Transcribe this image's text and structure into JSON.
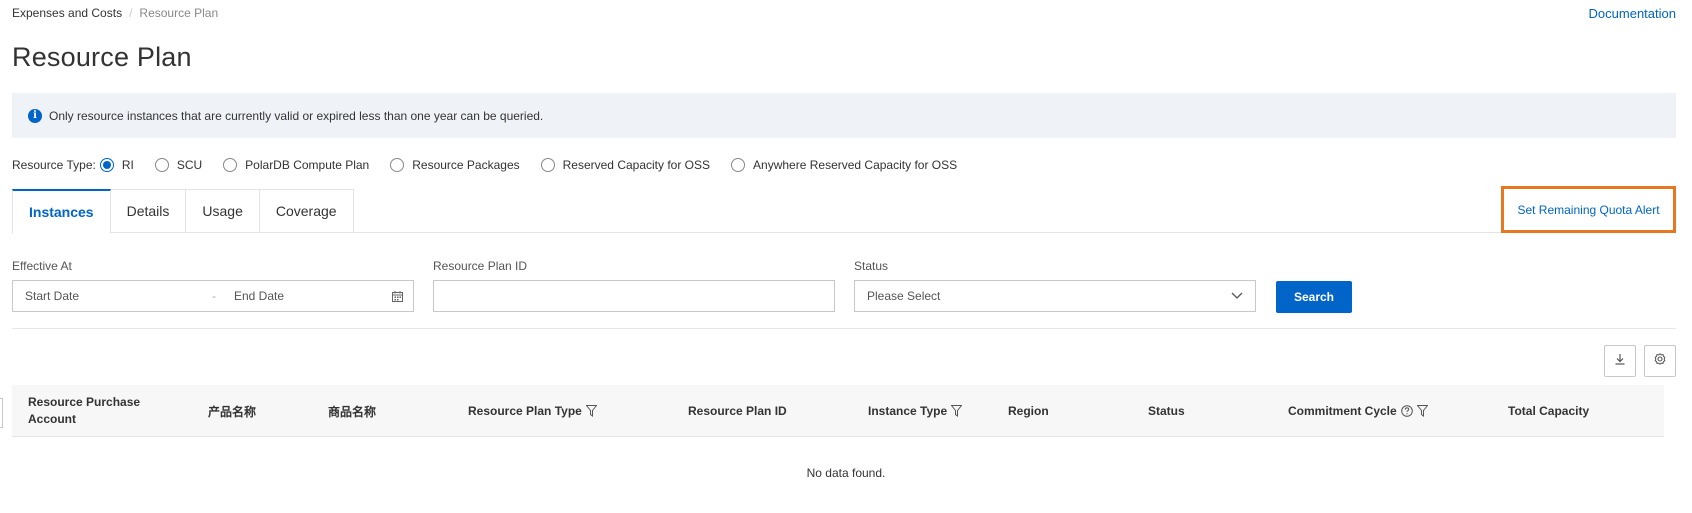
{
  "breadcrumb": {
    "parent": "Expenses and Costs",
    "separator": "/",
    "current": "Resource Plan"
  },
  "header": {
    "doc_link": "Documentation",
    "title": "Resource Plan"
  },
  "notice": {
    "icon": "info-icon",
    "text": "Only resource instances that are currently valid or expired less than one year can be queried."
  },
  "resource_type": {
    "label": "Resource Type:",
    "options": [
      {
        "label": "RI",
        "checked": true
      },
      {
        "label": "SCU",
        "checked": false
      },
      {
        "label": "PolarDB Compute Plan",
        "checked": false
      },
      {
        "label": "Resource Packages",
        "checked": false
      },
      {
        "label": "Reserved Capacity for OSS",
        "checked": false
      },
      {
        "label": "Anywhere Reserved Capacity for OSS",
        "checked": false
      }
    ]
  },
  "tabs": [
    {
      "label": "Instances",
      "active": true
    },
    {
      "label": "Details",
      "active": false
    },
    {
      "label": "Usage",
      "active": false
    },
    {
      "label": "Coverage",
      "active": false
    }
  ],
  "quota_alert": "Set Remaining Quota Alert",
  "filters": {
    "effective_at": {
      "label": "Effective At",
      "start_placeholder": "Start Date",
      "separator": "-",
      "end_placeholder": "End Date"
    },
    "resource_plan_id": {
      "label": "Resource Plan ID",
      "value": ""
    },
    "status": {
      "label": "Status",
      "placeholder": "Please Select"
    },
    "search_label": "Search"
  },
  "table": {
    "columns": [
      {
        "label": "Resource Purchase Account",
        "filter": false,
        "help": false
      },
      {
        "label": "产品名称",
        "filter": false,
        "help": false
      },
      {
        "label": "商品名称",
        "filter": false,
        "help": false
      },
      {
        "label": "Resource Plan Type",
        "filter": true,
        "help": false
      },
      {
        "label": "Resource Plan ID",
        "filter": false,
        "help": false
      },
      {
        "label": "Instance Type",
        "filter": true,
        "help": false
      },
      {
        "label": "Region",
        "filter": false,
        "help": false
      },
      {
        "label": "Status",
        "filter": false,
        "help": false
      },
      {
        "label": "Commitment Cycle",
        "filter": true,
        "help": true
      },
      {
        "label": "Total Capacity",
        "filter": false,
        "help": false
      }
    ],
    "empty_text": "No data found."
  },
  "colors": {
    "accent": "#0064c8",
    "highlight_border": "#e87722",
    "notice_bg": "#eff3f8"
  }
}
